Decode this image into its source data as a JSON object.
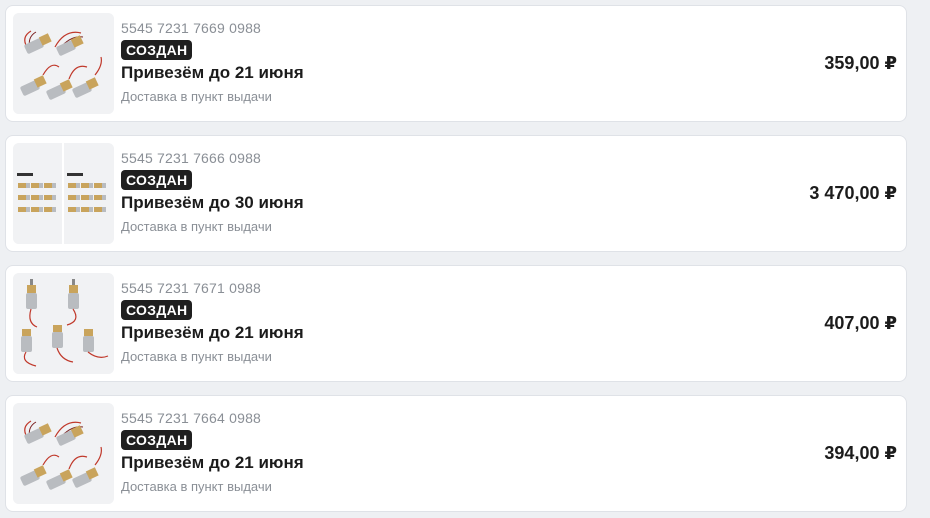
{
  "orders": [
    {
      "number": "5545 7231 7669 0988",
      "status": "СОЗДАН",
      "delivery": "Привезём до 21 июня",
      "method": "Доставка в пункт выдачи",
      "price": "359,00 ₽",
      "thumb_icon": "gear-motor-with-wires-image"
    },
    {
      "number": "5545 7231 7666 0988",
      "status": "СОЗДАН",
      "delivery": "Привезём до 30 июня",
      "method": "Доставка в пункт выдачи",
      "price": "3 470,00 ₽",
      "thumb_icon": "gear-motor-grid-image"
    },
    {
      "number": "5545 7231 7671 0988",
      "status": "СОЗДАН",
      "delivery": "Привезём до 21 июня",
      "method": "Доставка в пункт выдачи",
      "price": "407,00 ₽",
      "thumb_icon": "vertical-gear-motor-image"
    },
    {
      "number": "5545 7231 7664 0988",
      "status": "СОЗДАН",
      "delivery": "Привезём до 21 июня",
      "method": "Доставка в пункт выдачи",
      "price": "394,00 ₽",
      "thumb_icon": "gear-motor-with-wires-image"
    }
  ],
  "colors": {
    "badge_bg": "#1f1f1f",
    "card_bg": "#ffffff",
    "page_bg": "#eef0f3",
    "muted_text": "#8a8f96"
  }
}
